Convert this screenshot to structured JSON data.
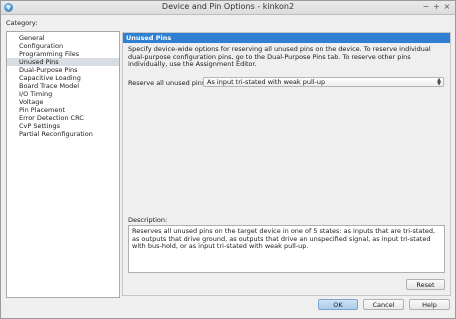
{
  "window": {
    "title": "Device and Pin Options - kinkon2",
    "controls": [
      "−",
      "+",
      "×"
    ]
  },
  "category": {
    "label": "Category:",
    "items": [
      "General",
      "Configuration",
      "Programming Files",
      "Unused Pins",
      "Dual-Purpose Pins",
      "Capacitive Loading",
      "Board Trace Model",
      "I/O Timing",
      "Voltage",
      "Pin Placement",
      "Error Detection CRC",
      "CvP Settings",
      "Partial Reconfiguration"
    ],
    "selected_index": 3
  },
  "panel": {
    "header": "Unused Pins",
    "description": "Specify device-wide options for reserving all unused pins on the device. To reserve individual dual-purpose configuration pins, go to the Dual-Purpose Pins tab. To reserve other pins individually, use the Assignment Editor.",
    "reserve_label": "Reserve all unused pins:",
    "reserve_value": "As input tri-stated with weak pull-up",
    "description_label": "Description:",
    "description_text": "Reserves all unused pins on the target device in one of 5 states: as inputs that are tri-stated, as outputs that drive ground, as outputs that drive an unspecified signal, as input tri-stated with bus-hold, or as input tri-stated with weak pull-up.",
    "reset_label": "Reset"
  },
  "footer": {
    "ok_label": "OK",
    "cancel_label": "Cancel",
    "help_label": "Help"
  }
}
